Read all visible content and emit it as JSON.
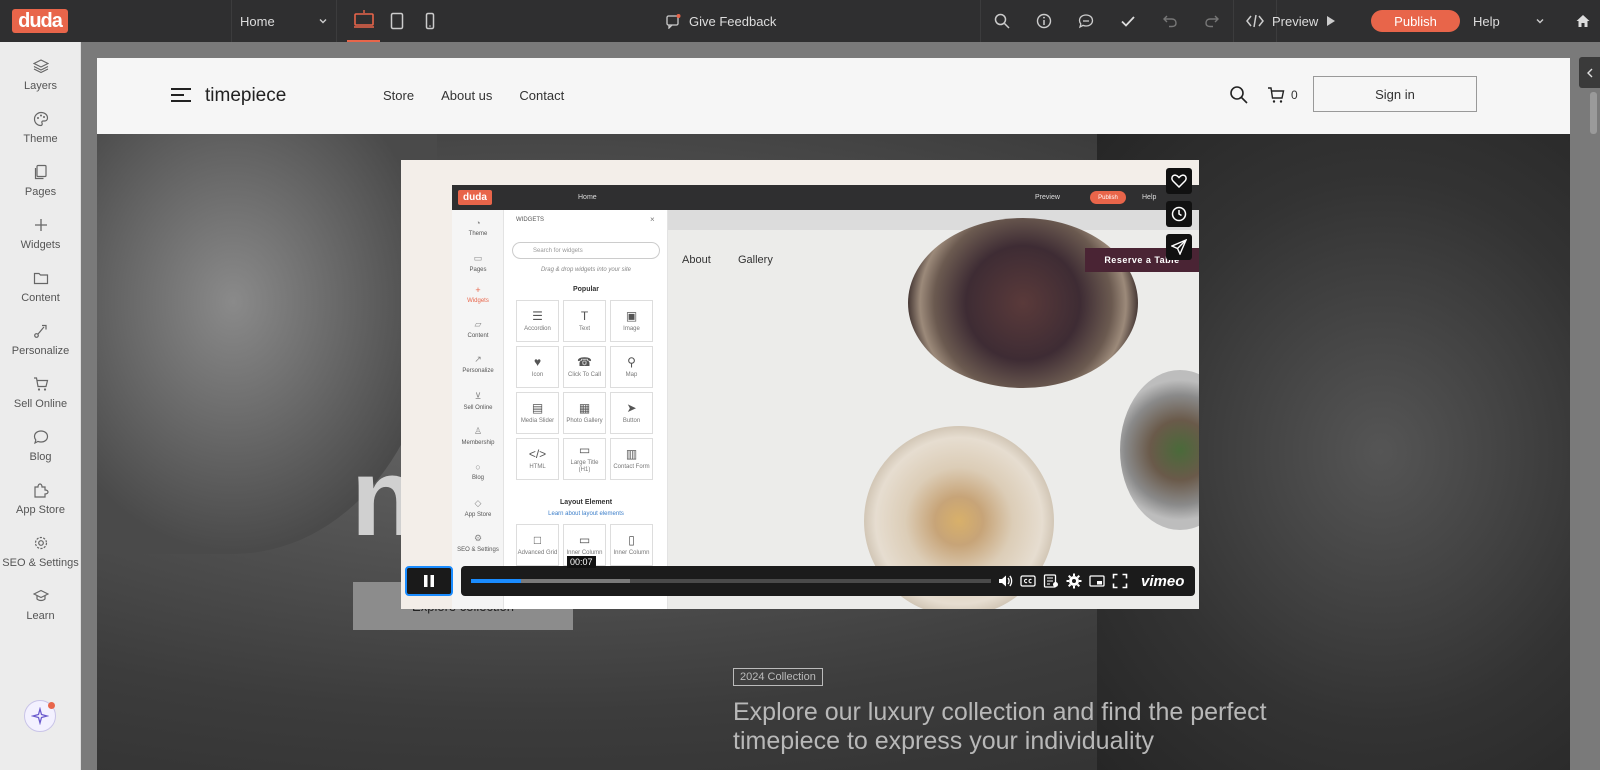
{
  "topbar": {
    "logo": "duda",
    "page_select": "Home",
    "feedback": "Give Feedback",
    "preview": "Preview",
    "publish": "Publish",
    "help": "Help"
  },
  "sidebar": {
    "items": [
      {
        "label": "Layers",
        "icon": "layers-icon"
      },
      {
        "label": "Theme",
        "icon": "palette-icon"
      },
      {
        "label": "Pages",
        "icon": "pages-icon"
      },
      {
        "label": "Widgets",
        "icon": "plus-icon"
      },
      {
        "label": "Content",
        "icon": "folder-icon"
      },
      {
        "label": "Personalize",
        "icon": "personalize-icon"
      },
      {
        "label": "Sell Online",
        "icon": "cart-icon"
      },
      {
        "label": "Blog",
        "icon": "chat-icon"
      },
      {
        "label": "App Store",
        "icon": "puzzle-icon"
      },
      {
        "label": "SEO & Settings",
        "icon": "gear-icon"
      },
      {
        "label": "Learn",
        "icon": "graduation-icon"
      }
    ]
  },
  "site": {
    "name": "timepiece",
    "nav": [
      "Store",
      "About us",
      "Contact"
    ],
    "cart_count": "0",
    "signin": "Sign in",
    "hero_big": "n",
    "explore": "Explore collection",
    "badge": "2024 Collection",
    "tagline": "Explore our luxury collection and find the perfect timepiece to express your individuality"
  },
  "video": {
    "time": "00:07",
    "brand": "vimeo",
    "progress": 0.096,
    "buffered": 0.305,
    "editor": {
      "logo": "duda",
      "home": "Home",
      "preview": "Preview",
      "publish": "Publish",
      "help": "Help",
      "panel_title": "WIDGETS",
      "search_placeholder": "Search for widgets",
      "drag_hint": "Drag & drop widgets into your site",
      "popular": "Popular",
      "layout_title": "Layout Element",
      "layout_link": "Learn about layout elements",
      "sidebar": [
        "Theme",
        "Pages",
        "Widgets",
        "Content",
        "Personalize",
        "Sell Online",
        "Membership",
        "Blog",
        "App Store",
        "SEO & Settings"
      ],
      "tiles": [
        "Accordion",
        "Text",
        "Image",
        "Icon",
        "Click To Call",
        "Map",
        "Media Slider",
        "Photo Gallery",
        "Button",
        "HTML",
        "Large Title (H1)",
        "Contact Form"
      ],
      "layout_tiles": [
        "Advanced Grid",
        "Inner Column",
        "Inner Column"
      ],
      "site_nav": [
        "About",
        "Gallery"
      ],
      "reserve": "Reserve a Table"
    }
  },
  "colors": {
    "brand": "#e8654a",
    "player_accent": "#1a8cff"
  }
}
